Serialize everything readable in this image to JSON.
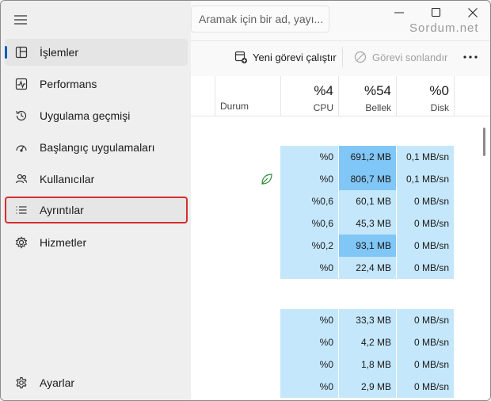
{
  "search": {
    "placeholder": "Aramak için bir ad, yayı..."
  },
  "watermark": "Sordum.net",
  "sidebar": {
    "items": [
      {
        "label": "İşlemler",
        "icon": "processes-icon"
      },
      {
        "label": "Performans",
        "icon": "performance-icon"
      },
      {
        "label": "Uygulama geçmişi",
        "icon": "history-icon"
      },
      {
        "label": "Başlangıç uygulamaları",
        "icon": "startup-icon"
      },
      {
        "label": "Kullanıcılar",
        "icon": "users-icon"
      },
      {
        "label": "Ayrıntılar",
        "icon": "details-icon"
      },
      {
        "label": "Hizmetler",
        "icon": "services-icon"
      }
    ],
    "settings_label": "Ayarlar"
  },
  "toolbar": {
    "new_task": "Yeni görevi çalıştır",
    "end_task": "Görevi sonlandır"
  },
  "table": {
    "columns": {
      "status": "Durum",
      "cpu": {
        "pct": "%4",
        "name": "CPU"
      },
      "memory": {
        "pct": "%54",
        "name": "Bellek"
      },
      "disk": {
        "pct": "%0",
        "name": "Disk"
      }
    },
    "group1": [
      {
        "cpu": "%0",
        "memory": "691,2 MB",
        "disk": "0,1 MB/sn",
        "mem_level": "high"
      },
      {
        "cpu": "%0",
        "memory": "806,7 MB",
        "disk": "0,1 MB/sn",
        "mem_level": "high",
        "status_icon": "leaf-icon"
      },
      {
        "cpu": "%0,6",
        "memory": "60,1 MB",
        "disk": "0 MB/sn",
        "mem_level": "low"
      },
      {
        "cpu": "%0,6",
        "memory": "45,3 MB",
        "disk": "0 MB/sn",
        "mem_level": "low"
      },
      {
        "cpu": "%0,2",
        "memory": "93,1 MB",
        "disk": "0 MB/sn",
        "mem_level": "mid"
      },
      {
        "cpu": "%0",
        "memory": "22,4 MB",
        "disk": "0 MB/sn",
        "mem_level": "low"
      }
    ],
    "group2": [
      {
        "cpu": "%0",
        "memory": "33,3 MB",
        "disk": "0 MB/sn",
        "mem_level": "low"
      },
      {
        "cpu": "%0",
        "memory": "4,2 MB",
        "disk": "0 MB/sn",
        "mem_level": "low"
      },
      {
        "cpu": "%0",
        "memory": "1,8 MB",
        "disk": "0 MB/sn",
        "mem_level": "low"
      },
      {
        "cpu": "%0",
        "memory": "2,9 MB",
        "disk": "0 MB/sn",
        "mem_level": "low"
      }
    ]
  },
  "colors": {
    "light_heat": "#c5e7fb",
    "high_heat": "#80c6f6",
    "accent": "#005fb8",
    "highlight_border": "#d32f2f"
  }
}
